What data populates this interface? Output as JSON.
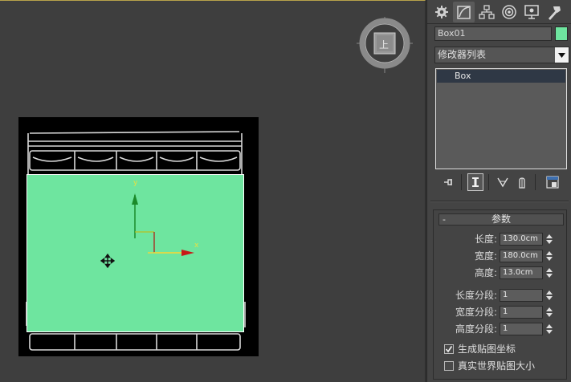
{
  "viewport": {
    "viewcube_face": "上",
    "gizmo": {
      "x_label": "x",
      "y_label": "y"
    }
  },
  "panel": {
    "tabs": [
      {
        "name": "create",
        "icon": "create-icon"
      },
      {
        "name": "modify",
        "icon": "modify-icon"
      },
      {
        "name": "hierarchy",
        "icon": "hierarchy-icon"
      },
      {
        "name": "motion",
        "icon": "motion-icon"
      },
      {
        "name": "display",
        "icon": "display-icon"
      },
      {
        "name": "utilities",
        "icon": "utilities-icon"
      }
    ],
    "object_name": "Box01",
    "object_color": "#6ee59f",
    "modifier_list_label": "修改器列表",
    "stack_items": [
      "Box"
    ]
  },
  "params": {
    "title": "参数",
    "collapse": "-",
    "length_label": "长度:",
    "length_value": "130.0cm",
    "width_label": "宽度:",
    "width_value": "180.0cm",
    "height_label": "高度:",
    "height_value": "13.0cm",
    "length_segs_label": "长度分段:",
    "length_segs_value": "1",
    "width_segs_label": "宽度分段:",
    "width_segs_value": "1",
    "height_segs_label": "高度分段:",
    "height_segs_value": "1",
    "gen_mapping_label": "生成贴图坐标",
    "gen_mapping_checked": true,
    "real_world_label": "真实世界贴图大小",
    "real_world_checked": false
  }
}
